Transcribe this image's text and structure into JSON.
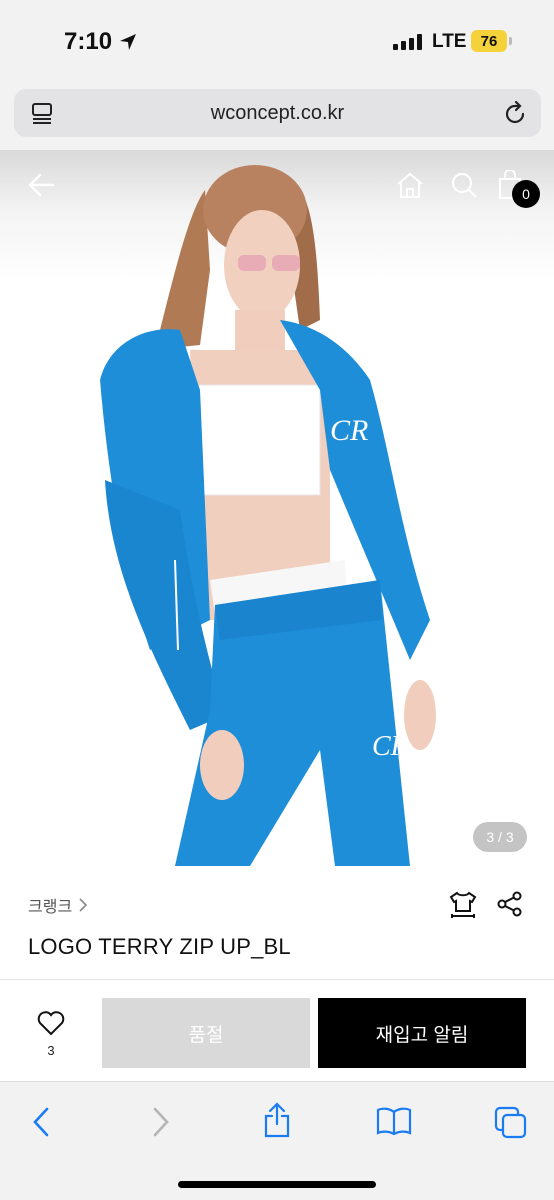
{
  "status_bar": {
    "time": "7:10",
    "network": "LTE",
    "battery": "76"
  },
  "browser": {
    "url": "wconcept.co.kr"
  },
  "product": {
    "image_counter": "3 / 3",
    "cart_count": "0",
    "brand": "크랭크",
    "title": "LOGO TERRY ZIP UP_BL",
    "like_count": "3",
    "soldout_label": "품절",
    "restock_label": "재입고 알림"
  },
  "image_description": {
    "text": "",
    "subject": "model wearing blue terry zip-up jacket and pants"
  },
  "colors": {
    "accent": "#1e8ed9",
    "primary_button": "#000000",
    "disabled_button": "#d9d9d9",
    "link": "#1a7cf2"
  },
  "icons": [
    "navigation-arrow-icon",
    "tabs-icon",
    "reload-icon",
    "back-arrow-icon",
    "home-icon",
    "search-icon",
    "shopping-bag-icon",
    "size-guide-icon",
    "share-icon",
    "heart-icon",
    "chevron-left-icon",
    "chevron-right-icon",
    "share-sheet-icon",
    "bookmarks-icon",
    "tab-switcher-icon"
  ]
}
